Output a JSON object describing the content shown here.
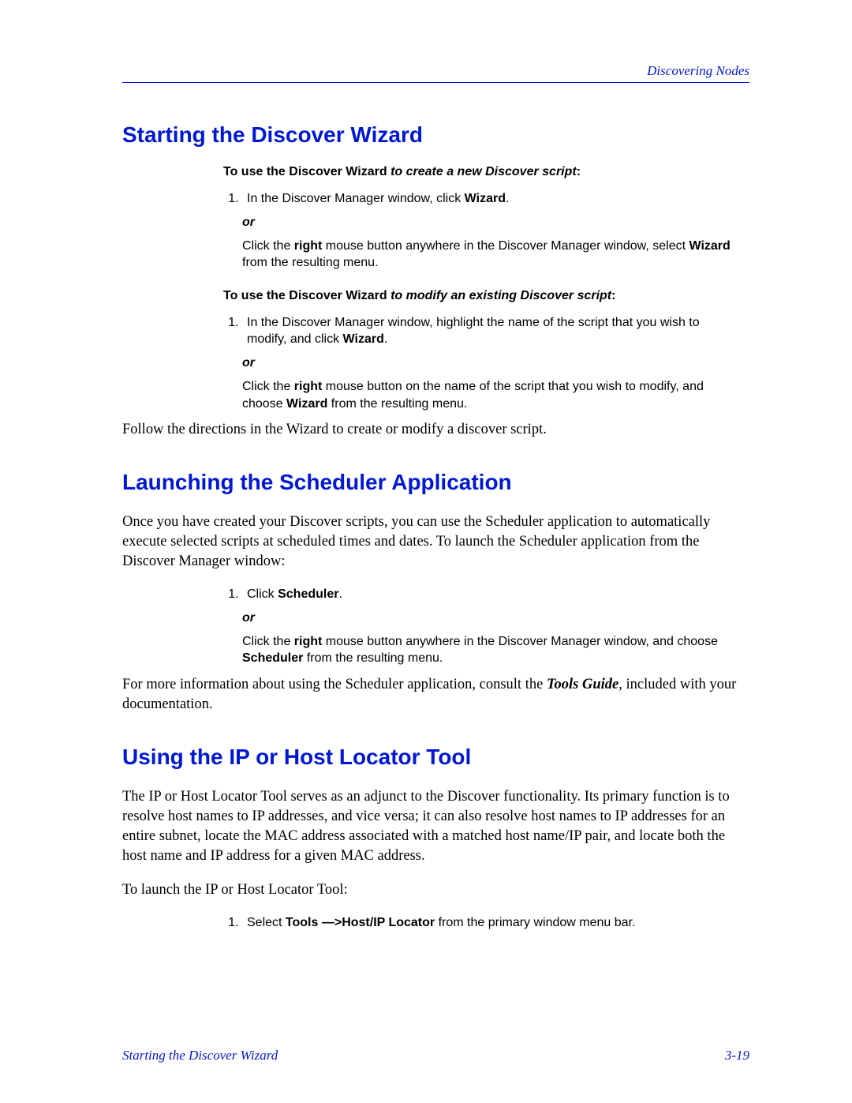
{
  "header": {
    "right": "Discovering Nodes"
  },
  "sections": {
    "s1": {
      "title": "Starting the Discover Wizard",
      "lead1_a": "To use the Discover Wizard ",
      "lead1_b": "to create a new Discover script",
      "lead1_c": ":",
      "step1_a": "In the Discover Manager window, click ",
      "step1_b": "Wizard",
      "step1_c": ".",
      "or": "or",
      "alt1_a": "Click the ",
      "alt1_b": "right",
      "alt1_c": " mouse button anywhere in the Discover Manager window, select ",
      "alt1_d": "Wizard",
      "alt1_e": " from the resulting menu.",
      "lead2_a": "To use the Discover Wizard ",
      "lead2_b": "to modify an existing Discover script",
      "lead2_c": ":",
      "step2_a": "In the Discover Manager window, highlight the name of the script that you wish to modify, and click ",
      "step2_b": "Wizard",
      "step2_c": ".",
      "alt2_a": "Click the ",
      "alt2_b": "right",
      "alt2_c": " mouse button on the name of the script that you wish to modify, and choose ",
      "alt2_d": "Wizard",
      "alt2_e": " from the resulting menu.",
      "follow": "Follow the directions in the Wizard to create or modify a discover script."
    },
    "s2": {
      "title": "Launching the Scheduler Application",
      "intro": "Once you have created your Discover scripts, you can use the Scheduler application to automatically execute selected scripts at scheduled times and dates. To launch the Scheduler application from the Discover Manager window:",
      "step1_a": "Click ",
      "step1_b": "Scheduler",
      "step1_c": ".",
      "or": "or",
      "alt1_a": "Click the ",
      "alt1_b": "right",
      "alt1_c": " mouse button anywhere in the Discover Manager window, and choose ",
      "alt1_d": "Scheduler",
      "alt1_e": " from the resulting menu.",
      "more_a": "For more information about using the Scheduler application, consult the ",
      "more_b": "Tools Guide",
      "more_c": ", included with your documentation."
    },
    "s3": {
      "title": "Using the IP or Host Locator Tool",
      "intro": "The IP or Host Locator Tool serves as an adjunct to the Discover functionality. Its primary function is to resolve host names to IP addresses, and vice versa; it can also resolve host names to IP addresses for an entire subnet, locate the MAC address associated with a matched host name/IP pair, and locate both the host name and IP address for a given MAC address.",
      "launch": "To launch the IP or Host Locator Tool:",
      "step1_a": "Select ",
      "step1_b": "Tools —>Host/IP Locator",
      "step1_c": " from the primary window menu bar."
    }
  },
  "footer": {
    "left": "Starting the Discover Wizard",
    "right": "3-19"
  }
}
